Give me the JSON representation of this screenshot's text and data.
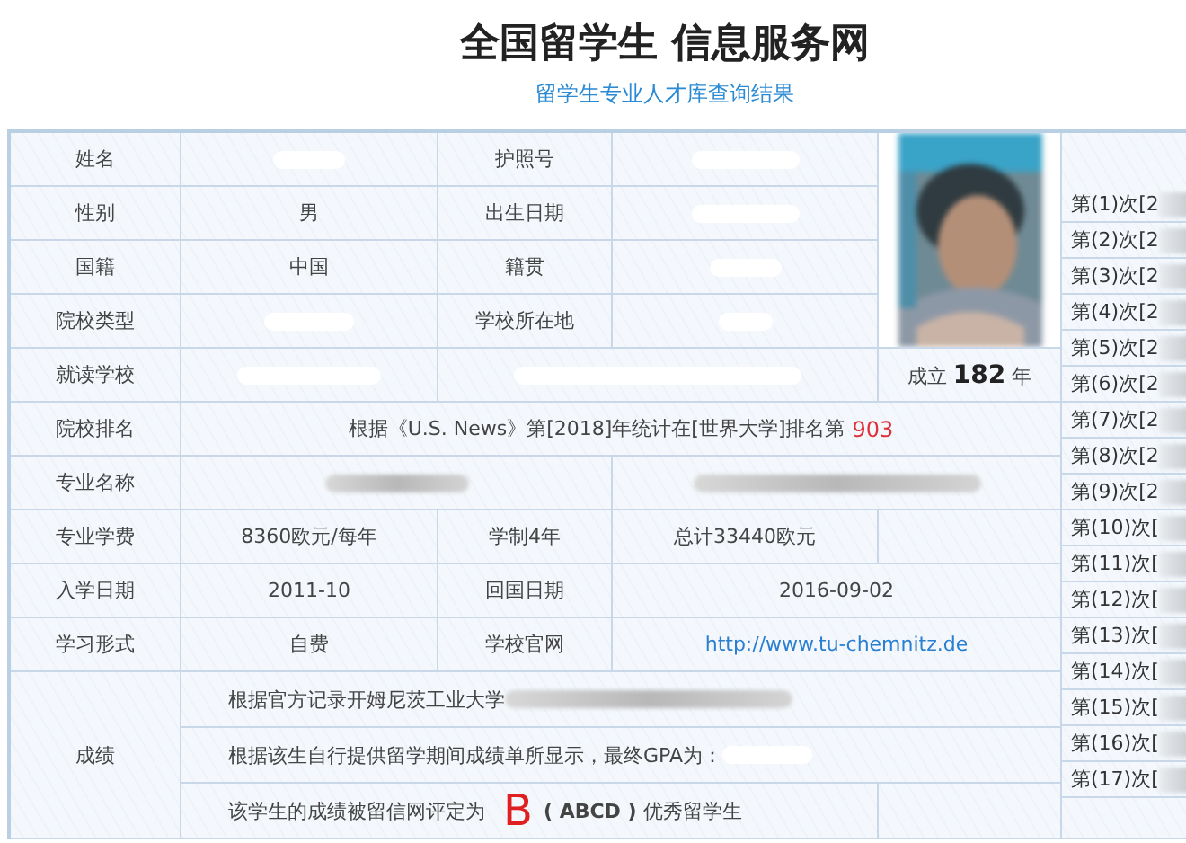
{
  "header": {
    "title": "全国留学生 信息服务网",
    "subtitle": "留学生专业人才库查询结果"
  },
  "record": {
    "name_label": "姓名",
    "passport_label": "护照号",
    "gender_label": "性别",
    "gender": "男",
    "birth_label": "出生日期",
    "nationality_label": "国籍",
    "nationality": "中国",
    "origin_label": "籍贯",
    "school_type_label": "院校类型",
    "school_location_label": "学校所在地",
    "school_label": "就读学校",
    "founded": "成立 **182** 年",
    "ranking_label": "院校排名",
    "ranking_text": "根据《U.S. News》第[2018]年统计在[世界大学]排名第",
    "ranking_value": "903",
    "major_label": "专业名称",
    "tuition_label": "专业学费",
    "tuition": "8360欧元/每年",
    "duration": "学制4年",
    "total": "总计33440欧元",
    "enroll_label": "入学日期",
    "enroll": "2011-10",
    "return_label": "回国日期",
    "return_date": "2016-09-02",
    "mode_label": "学习形式",
    "mode": "自费",
    "website_label": "学校官网",
    "website": "http://www.tu-chemnitz.de"
  },
  "grades": {
    "label": "成绩",
    "official": "根据官方记录开姆尼茨工业大学",
    "gpa": "根据该生自行提供留学期间成绩单所显示，最终GPA为：",
    "rating_prefix": "该学生的成绩被留信网评定为",
    "grade": "B",
    "rating_suffix": "**( ABCD )** 优秀留学生"
  },
  "side_entries": [
    "第(1)次[2",
    "第(2)次[2",
    "第(3)次[2",
    "第(4)次[2",
    "第(5)次[2",
    "第(6)次[2",
    "第(7)次[2",
    "第(8)次[2",
    "第(9)次[2",
    "第(10)次[",
    "第(11)次[",
    "第(12)次[",
    "第(13)次[",
    "第(14)次[",
    "第(15)次[",
    "第(16)次[",
    "第(17)次["
  ]
}
